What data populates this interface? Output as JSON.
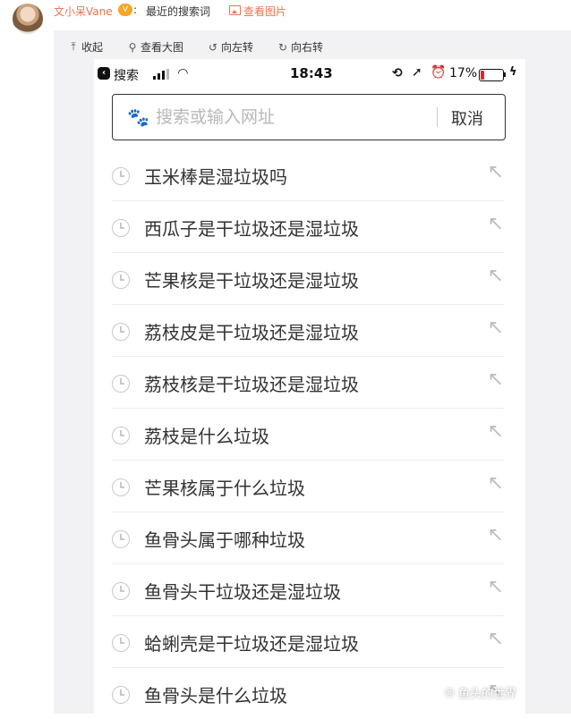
{
  "post": {
    "author": "文小呆Vane",
    "vip_badge": "V",
    "colon": ":",
    "text": "最近的搜索词",
    "image_link": "查看图片"
  },
  "toolbar": {
    "collapse": "收起",
    "view_large": "查看大图",
    "rotate_left": "向左转",
    "rotate_right": "向右转"
  },
  "status_bar": {
    "back_app": "搜索",
    "time": "18:43",
    "battery": "17%",
    "battery_level": 0.17
  },
  "search": {
    "placeholder": "搜索或输入网址",
    "cancel": "取消"
  },
  "history": [
    "玉米棒是湿垃圾吗",
    "西瓜子是干垃圾还是湿垃圾",
    "芒果核是干垃圾还是湿垃圾",
    "荔枝皮是干垃圾还是湿垃圾",
    "荔枝核是干垃圾还是湿垃圾",
    "荔枝是什么垃圾",
    "芒果核属于什么垃圾",
    "鱼骨头属于哪种垃圾",
    "鱼骨头干垃圾还是湿垃圾",
    "蛤蜊壳是干垃圾还是湿垃圾",
    "鱼骨头是什么垃圾"
  ],
  "watermark": "鱼头的世界",
  "colors": {
    "link": "#eb7350",
    "panel": "#f2f2f5",
    "battery_low": "#e22222",
    "baidu_blue": "#3262e6"
  },
  "icons": {
    "collapse": "arrow-up-icon",
    "view_large": "magnifier-icon",
    "rotate_left": "rotate-left-icon",
    "rotate_right": "rotate-right-icon",
    "row": "clock-icon",
    "row_action": "fill-arrow-icon"
  }
}
